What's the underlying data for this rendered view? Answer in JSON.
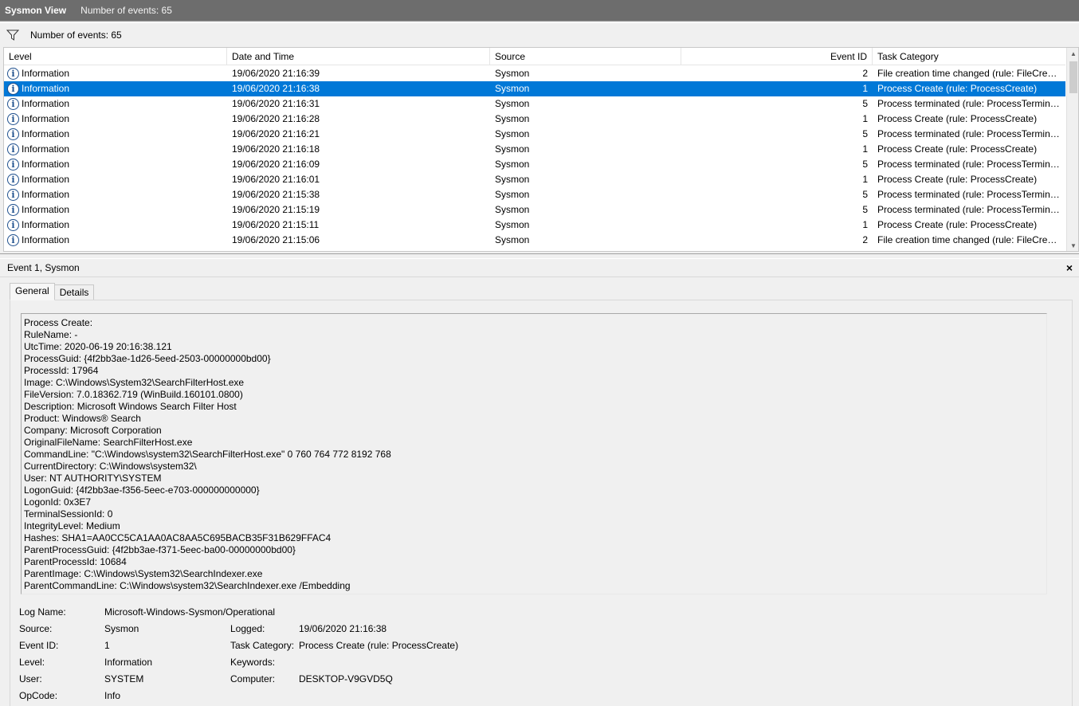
{
  "title": {
    "app": "Sysmon View",
    "count": "Number of events: 65"
  },
  "filter": {
    "label": "Number of events: 65",
    "icon": "filter-icon"
  },
  "columns": {
    "level": "Level",
    "date": "Date and Time",
    "source": "Source",
    "event_id": "Event ID",
    "task": "Task Category"
  },
  "events": [
    {
      "level": "Information",
      "date": "19/06/2020 21:16:39",
      "source": "Sysmon",
      "event_id": "2",
      "task": "File creation time changed (rule: FileCreateTime)"
    },
    {
      "level": "Information",
      "date": "19/06/2020 21:16:38",
      "source": "Sysmon",
      "event_id": "1",
      "task": "Process Create (rule: ProcessCreate)"
    },
    {
      "level": "Information",
      "date": "19/06/2020 21:16:31",
      "source": "Sysmon",
      "event_id": "5",
      "task": "Process terminated (rule: ProcessTerminate)"
    },
    {
      "level": "Information",
      "date": "19/06/2020 21:16:28",
      "source": "Sysmon",
      "event_id": "1",
      "task": "Process Create (rule: ProcessCreate)"
    },
    {
      "level": "Information",
      "date": "19/06/2020 21:16:21",
      "source": "Sysmon",
      "event_id": "5",
      "task": "Process terminated (rule: ProcessTerminate)"
    },
    {
      "level": "Information",
      "date": "19/06/2020 21:16:18",
      "source": "Sysmon",
      "event_id": "1",
      "task": "Process Create (rule: ProcessCreate)"
    },
    {
      "level": "Information",
      "date": "19/06/2020 21:16:09",
      "source": "Sysmon",
      "event_id": "5",
      "task": "Process terminated (rule: ProcessTerminate)"
    },
    {
      "level": "Information",
      "date": "19/06/2020 21:16:01",
      "source": "Sysmon",
      "event_id": "1",
      "task": "Process Create (rule: ProcessCreate)"
    },
    {
      "level": "Information",
      "date": "19/06/2020 21:15:38",
      "source": "Sysmon",
      "event_id": "5",
      "task": "Process terminated (rule: ProcessTerminate)"
    },
    {
      "level": "Information",
      "date": "19/06/2020 21:15:19",
      "source": "Sysmon",
      "event_id": "5",
      "task": "Process terminated (rule: ProcessTerminate)"
    },
    {
      "level": "Information",
      "date": "19/06/2020 21:15:11",
      "source": "Sysmon",
      "event_id": "1",
      "task": "Process Create (rule: ProcessCreate)"
    },
    {
      "level": "Information",
      "date": "19/06/2020 21:15:06",
      "source": "Sysmon",
      "event_id": "2",
      "task": "File creation time changed (rule: FileCreateTime)"
    }
  ],
  "selected_index": 1,
  "detail": {
    "header": "Event 1, Sysmon",
    "close": "×",
    "tabs": [
      "General",
      "Details"
    ],
    "text_lines": [
      "Process Create:",
      "RuleName: -",
      "UtcTime: 2020-06-19 20:16:38.121",
      "ProcessGuid: {4f2bb3ae-1d26-5eed-2503-00000000bd00}",
      "ProcessId: 17964",
      "Image: C:\\Windows\\System32\\SearchFilterHost.exe",
      "FileVersion: 7.0.18362.719 (WinBuild.160101.0800)",
      "Description: Microsoft Windows Search Filter Host",
      "Product: Windows® Search",
      "Company: Microsoft Corporation",
      "OriginalFileName: SearchFilterHost.exe",
      "CommandLine: \"C:\\Windows\\system32\\SearchFilterHost.exe\" 0 760 764 772 8192 768",
      "CurrentDirectory: C:\\Windows\\system32\\",
      "User: NT AUTHORITY\\SYSTEM",
      "LogonGuid: {4f2bb3ae-f356-5eec-e703-000000000000}",
      "LogonId: 0x3E7",
      "TerminalSessionId: 0",
      "IntegrityLevel: Medium",
      "Hashes: SHA1=AA0CC5CA1AA0AC8AA5C695BACB35F31B629FFAC4",
      "ParentProcessGuid: {4f2bb3ae-f371-5eec-ba00-00000000bd00}",
      "ParentProcessId: 10684",
      "ParentImage: C:\\Windows\\System32\\SearchIndexer.exe",
      "ParentCommandLine: C:\\Windows\\system32\\SearchIndexer.exe /Embedding"
    ],
    "props": {
      "log_name_label": "Log Name:",
      "log_name": "Microsoft-Windows-Sysmon/Operational",
      "source_label": "Source:",
      "source": "Sysmon",
      "logged_label": "Logged:",
      "logged": "19/06/2020 21:16:38",
      "event_id_label": "Event ID:",
      "event_id": "1",
      "task_label": "Task Category:",
      "task": "Process Create (rule: ProcessCreate)",
      "level_label": "Level:",
      "level": "Information",
      "keywords_label": "Keywords:",
      "keywords": "",
      "user_label": "User:",
      "user": "SYSTEM",
      "computer_label": "Computer:",
      "computer": "DESKTOP-V9GVD5Q",
      "opcode_label": "OpCode:",
      "opcode": "Info"
    }
  },
  "colors": {
    "selection": "#0078d7",
    "titlebar": "#6d6d6d",
    "info_icon": "#1e4f8d"
  }
}
